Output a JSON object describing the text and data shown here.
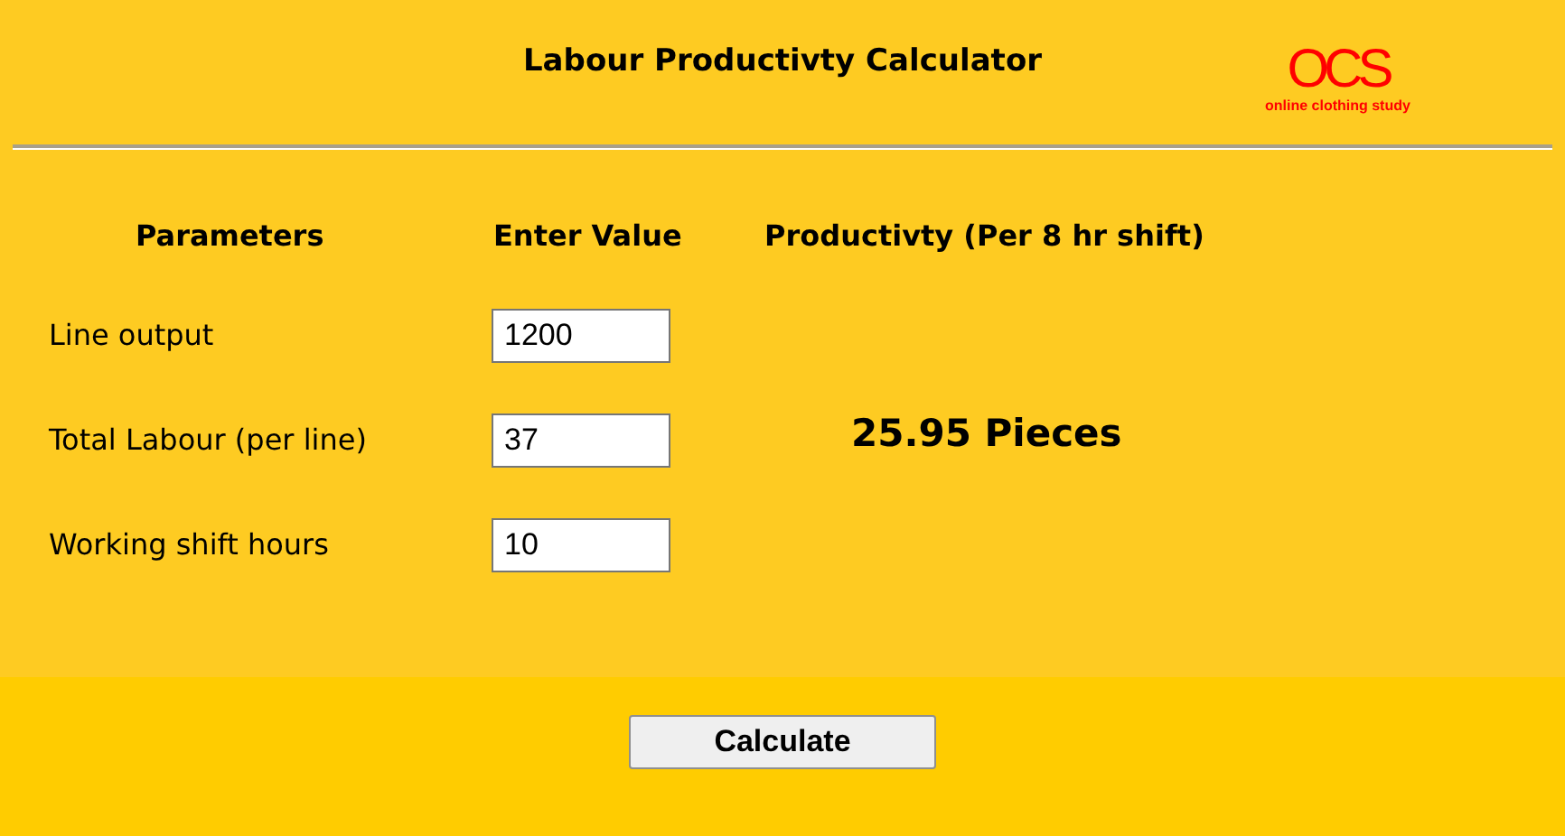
{
  "title": "Labour Productivty Calculator",
  "logo": {
    "mark": "OCS",
    "tagline": "online clothing study"
  },
  "columns": [
    "Parameters",
    "Enter Value",
    "Productivty (Per 8 hr shift)"
  ],
  "fields": [
    {
      "label": "Line output",
      "value": "1200"
    },
    {
      "label": "Total Labour (per line)",
      "value": "37"
    },
    {
      "label": "Working shift hours",
      "value": "10"
    }
  ],
  "result": "25.95 Pieces",
  "button": "Calculate"
}
